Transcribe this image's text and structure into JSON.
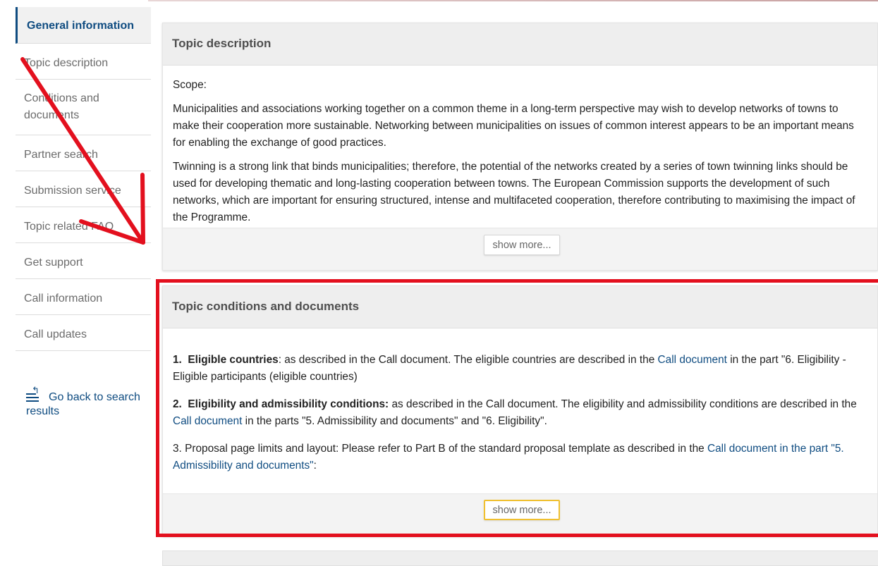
{
  "sidebar": {
    "items": [
      {
        "label": "General information",
        "active": true
      },
      {
        "label": "Topic description"
      },
      {
        "label": "Conditions and documents"
      },
      {
        "label": "Partner search"
      },
      {
        "label": "Submission service"
      },
      {
        "label": "Topic related FAQ"
      },
      {
        "label": "Get support"
      },
      {
        "label": "Call information"
      },
      {
        "label": "Call updates"
      }
    ],
    "back_link": "Go back to search results",
    "back_icon": "back-to-list-icon"
  },
  "topic_description": {
    "title": "Topic description",
    "scope_label": "Scope:",
    "para1": "Municipalities and associations working together on a common theme in a long-term perspective may wish to develop networks of towns to make their cooperation more sustainable. Networking between municipalities on issues of common interest appears to be an important means for enabling the exchange of good practices.",
    "para2": "Twinning is a strong link that binds municipalities; therefore, the potential of the networks created by a series of town twinning links should be used for developing thematic and long-lasting cooperation between towns. The European Commission supports the development of such networks, which are important for ensuring structured, intense and multifaceted cooperation, therefore contributing to maximising the impact of the Programme.",
    "show_more": "show more..."
  },
  "topic_conditions": {
    "title": "Topic conditions and documents",
    "item1_num": "1.",
    "item1_bold": "Eligible countries",
    "item1_text": ": as described in the Call document. The eligible countries are described in the ",
    "item1_link": "Call document",
    "item1_tail": " in the part \"6. Eligibility - Eligible participants (eligible countries)",
    "item2_num": "2.",
    "item2_bold": "Eligibility and admissibility conditions:",
    "item2_text": " as described in the Call document. The eligibility and admissibility conditions are described in the ",
    "item2_link": "Call document",
    "item2_tail": " in the parts \"5. Admissibility and documents\" and \"6. Eligibility\".",
    "item3_text": "3.  Proposal page limits and layout: Please refer to Part B of the standard proposal template as described in the ",
    "item3_link": "Call document in the part \"5. Admissibility and documents\"",
    "item3_tail": ":",
    "show_more": "show more..."
  },
  "annotations": {
    "arrow_color": "#e3101e",
    "highlight_color": "#e3101e"
  }
}
